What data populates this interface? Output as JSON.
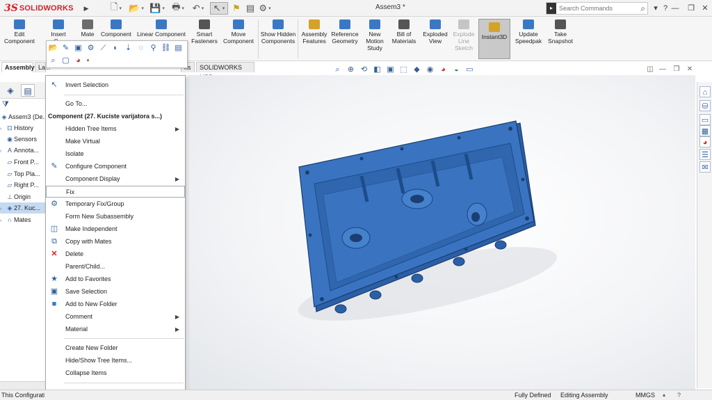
{
  "app": {
    "brand_ds": "3S",
    "brand_name": "SOLIDWORKS",
    "doc_title": "Assem3 *"
  },
  "search": {
    "placeholder": "Search Commands"
  },
  "quick_access": [
    "new-icon",
    "open-icon",
    "save-icon",
    "print-icon",
    "undo-icon",
    "select-icon",
    "rebuild-icon",
    "file-properties-icon",
    "options-icon"
  ],
  "window_controls": {
    "help": "?",
    "minimize": "—",
    "restore": "❐",
    "close": "✕"
  },
  "ribbon": {
    "buttons": [
      {
        "name": "edit-component",
        "label": "Edit Component",
        "color": "#3b78c4"
      },
      {
        "name": "insert-components",
        "label": "Insert C...",
        "color": "#3b78c4"
      },
      {
        "name": "mate",
        "label": "Mate",
        "color": "#6c6c6c"
      },
      {
        "name": "component-preview",
        "label": "Component",
        "color": "#3b78c4"
      },
      {
        "name": "linear-component-pattern",
        "label": "Linear Component",
        "color": "#3b78c4"
      },
      {
        "name": "smart-fasteners",
        "label": "Smart Fasteners",
        "color": "#555555"
      },
      {
        "name": "move-component",
        "label": "Move Component",
        "color": "#3b78c4"
      },
      {
        "name": "show-hidden-components",
        "label": "Show Hidden Components",
        "color": "#3b78c4"
      },
      {
        "name": "assembly-features",
        "label": "Assembly Features",
        "color": "#d4a22a"
      },
      {
        "name": "reference-geometry",
        "label": "Reference Geometry",
        "color": "#3b78c4"
      },
      {
        "name": "new-motion-study",
        "label": "New Motion Study",
        "color": "#3b78c4"
      },
      {
        "name": "bill-of-materials",
        "label": "Bill of Materials",
        "color": "#555555"
      },
      {
        "name": "exploded-view",
        "label": "Exploded View",
        "color": "#3b78c4"
      },
      {
        "name": "explode-line-sketch",
        "label": "Explode Line Sketch",
        "color": "#b5b5b5"
      },
      {
        "name": "instant3d",
        "label": "Instant3D",
        "color": "#d4a22a"
      },
      {
        "name": "update-speedpak",
        "label": "Update Speedpak",
        "color": "#3b78c4"
      },
      {
        "name": "take-snapshot",
        "label": "Take Snapshot",
        "color": "#555555"
      }
    ]
  },
  "tabs": [
    {
      "label": "Assembly"
    },
    {
      "label": "La..."
    },
    {
      "label": "ns"
    },
    {
      "label": "SOLIDWORKS MBD"
    }
  ],
  "feature_tree": {
    "root": "Assem3  (De...",
    "items": [
      {
        "label": "History",
        "expand": "›"
      },
      {
        "label": "Sensors",
        "expand": ""
      },
      {
        "label": "Annota...",
        "expand": "›"
      },
      {
        "label": "Front P...",
        "expand": ""
      },
      {
        "label": "Top Pla...",
        "expand": ""
      },
      {
        "label": "Right P...",
        "expand": ""
      },
      {
        "label": "Origin",
        "expand": ""
      },
      {
        "label": "27. Kuc...",
        "expand": "›"
      },
      {
        "label": "Mates",
        "expand": "›"
      }
    ]
  },
  "context_menu": {
    "items": [
      {
        "label": "Invert Selection",
        "icon": "invert-selection-icon"
      },
      {
        "label": "Go To...",
        "icon": ""
      },
      {
        "label": "Component (27. Kuciste varijatora s...)",
        "header": true
      },
      {
        "label": "Hidden Tree Items",
        "submenu": true
      },
      {
        "label": "Make Virtual"
      },
      {
        "label": "Isolate"
      },
      {
        "label": "Configure Component",
        "icon": "configure-component-icon"
      },
      {
        "label": "Component Display",
        "submenu": true
      },
      {
        "label": "Fix",
        "highlight": true
      },
      {
        "label": "Temporary Fix/Group",
        "icon": "temporary-fix-icon"
      },
      {
        "label": "Form New Subassembly"
      },
      {
        "label": "Make Independent",
        "icon": "make-independent-icon"
      },
      {
        "label": "Copy with Mates",
        "icon": "copy-with-mates-icon"
      },
      {
        "label": "Delete",
        "icon": "delete-icon"
      },
      {
        "label": "Parent/Child..."
      },
      {
        "label": "Add to Favorites",
        "icon": "add-favorites-icon"
      },
      {
        "label": "Save Selection",
        "icon": "save-selection-icon"
      },
      {
        "label": "Add to New Folder",
        "icon": "folder-icon"
      },
      {
        "label": "Comment",
        "submenu": true
      },
      {
        "label": "Material",
        "submenu": true
      },
      {
        "label": "Create New Folder"
      },
      {
        "label": "Hide/Show Tree Items..."
      },
      {
        "label": "Collapse Items"
      }
    ],
    "more_glyph": "⌄"
  },
  "status_bar": {
    "left": "This Configurati...",
    "state": "Fully Defined",
    "mode": "Editing Assembly",
    "units": "MMGS"
  },
  "colors": {
    "part_blue": "#3a74c1",
    "part_dark": "#1f4f8f",
    "accent_red": "#d2232a"
  }
}
